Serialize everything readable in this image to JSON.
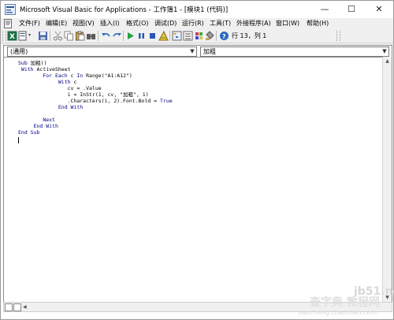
{
  "window": {
    "title": "Microsoft Visual Basic for Applications - 工作簿1 - [模块1 (代码)]",
    "controls": {
      "minimize": "—",
      "maximize": "☐",
      "close": "✕"
    }
  },
  "menu": {
    "items": [
      {
        "label": "文件(F)"
      },
      {
        "label": "编辑(E)"
      },
      {
        "label": "视图(V)"
      },
      {
        "label": "插入(I)"
      },
      {
        "label": "格式(O)"
      },
      {
        "label": "调试(D)"
      },
      {
        "label": "运行(R)"
      },
      {
        "label": "工具(T)"
      },
      {
        "label": "外接程序(A)"
      },
      {
        "label": "窗口(W)"
      },
      {
        "label": "帮助(H)"
      }
    ]
  },
  "toolbar": {
    "position_text": "行 13，列 1",
    "icons": [
      "excel-icon",
      "insert-module-icon",
      "cut-icon",
      "copy-icon",
      "paste-icon",
      "find-icon",
      "undo-icon",
      "redo-icon",
      "run-icon",
      "break-icon",
      "reset-icon",
      "design-mode-icon",
      "project-explorer-icon",
      "properties-icon",
      "object-browser-icon",
      "toolbox-icon",
      "help-icon"
    ]
  },
  "module": {
    "object_dropdown": "(通用)",
    "procedure_dropdown": "加粗",
    "code_lines": [
      "Sub 加粗()",
      " With ActiveSheet",
      "        For Each c In Range(\"A1:A12\")",
      "             With c",
      "                cv = .Value",
      "                i = InStr(1, cv, \"加粗\", 1)",
      "                .Characters(i, 2).Font.Bold = True",
      "             End With",
      "",
      "        Next",
      "     End With",
      "End Sub"
    ]
  },
  "watermark": {
    "site": "jb51.net",
    "brand": "查字典 教程网",
    "url": "jiaocheng.chazidian.com"
  }
}
